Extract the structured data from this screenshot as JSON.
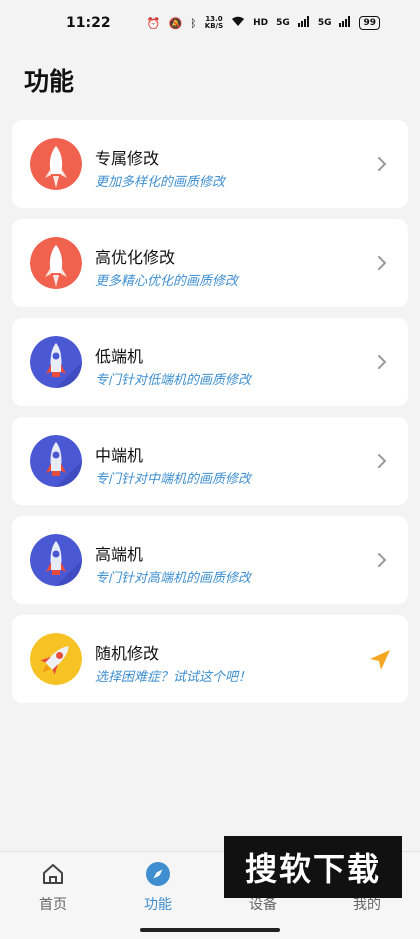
{
  "status_bar": {
    "time": "11:22",
    "speed": "13.0",
    "speed_unit": "KB/S",
    "hd": "HD",
    "net1": "5G",
    "net2": "5G",
    "battery": "99",
    "icons": [
      "alarm-icon",
      "mute-icon",
      "bluetooth-icon",
      "wifi-icon",
      "signal-icon",
      "signal-icon",
      "battery-icon"
    ]
  },
  "page": {
    "title": "功能"
  },
  "features": [
    {
      "title": "专属修改",
      "subtitle": "更加多样化的画质修改",
      "icon": "rocket-red-icon",
      "action": "chevron-right-icon"
    },
    {
      "title": "高优化修改",
      "subtitle": "更多精心优化的画质修改",
      "icon": "rocket-red-icon",
      "action": "chevron-right-icon"
    },
    {
      "title": "低端机",
      "subtitle": "专门针对低端机的画质修改",
      "icon": "rocket-blue-icon",
      "action": "chevron-right-icon"
    },
    {
      "title": "中端机",
      "subtitle": "专门针对中端机的画质修改",
      "icon": "rocket-blue-icon",
      "action": "chevron-right-icon"
    },
    {
      "title": "高端机",
      "subtitle": "专门针对高端机的画质修改",
      "icon": "rocket-blue-icon",
      "action": "chevron-right-icon"
    },
    {
      "title": "随机修改",
      "subtitle": "选择困难症？试试这个吧！",
      "icon": "rocket-yellow-icon",
      "action": "send-icon"
    }
  ],
  "nav": [
    {
      "label": "首页",
      "icon": "home-icon",
      "active": false
    },
    {
      "label": "功能",
      "icon": "compass-icon",
      "active": true
    },
    {
      "label": "设备",
      "icon": "device-icon",
      "active": false
    },
    {
      "label": "我的",
      "icon": "profile-icon",
      "active": false
    }
  ],
  "watermark": "搜软下载",
  "colors": {
    "accent": "#3f8fd0",
    "red_icon_bg": "#f0624e",
    "blue_icon_bg": "#4a58d4",
    "yellow_icon_bg": "#f7c324",
    "send_arrow": "#f5a623"
  }
}
